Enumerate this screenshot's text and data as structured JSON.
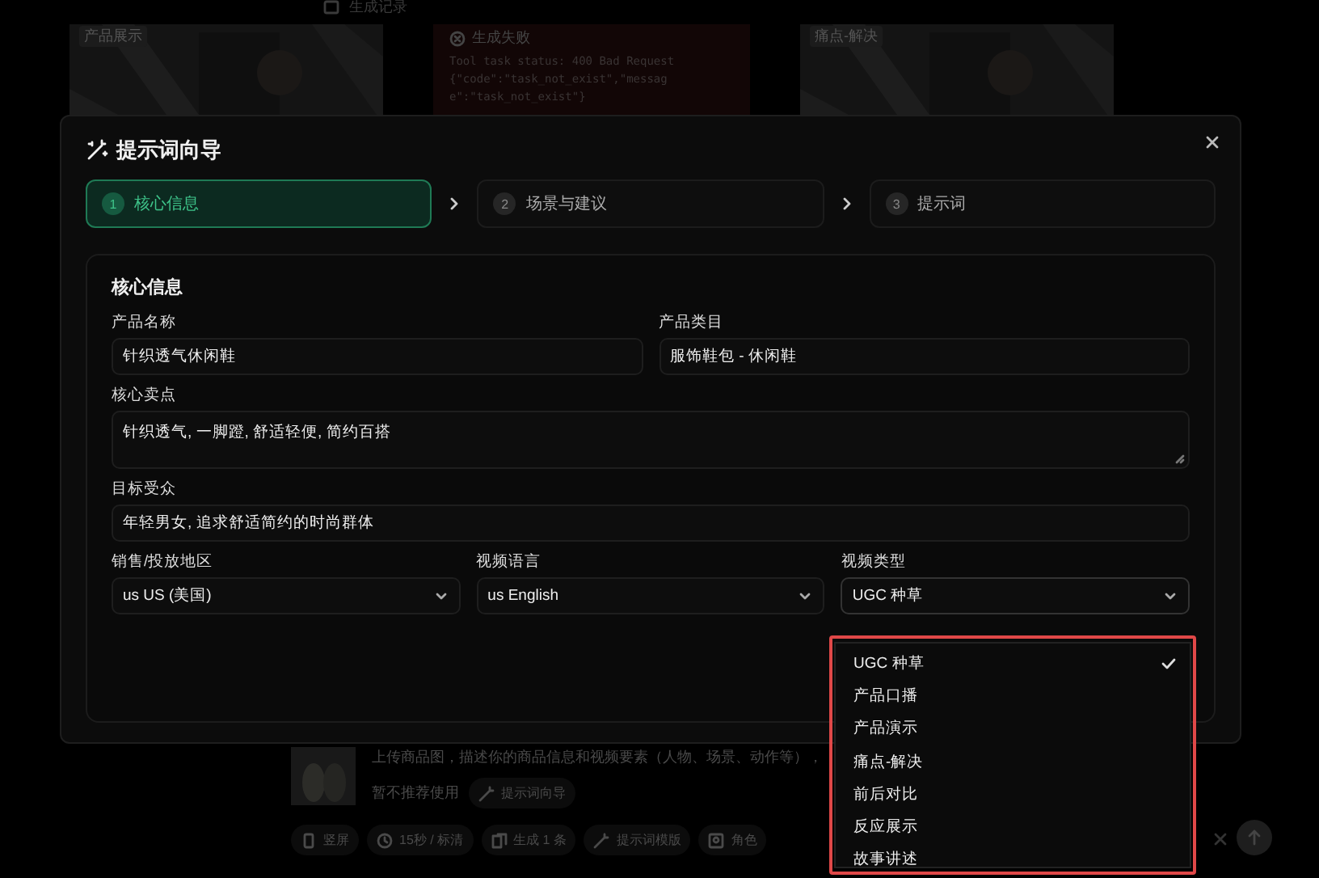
{
  "background": {
    "breadcrumb": "生成记录",
    "cards": [
      {
        "kind": "picture",
        "tag": "产品展示"
      },
      {
        "kind": "error",
        "title": "生成失败",
        "message": "Tool task status: 400 Bad Request {\"code\":\"task_not_exist\",\"message\":\"task_not_exist\"}"
      },
      {
        "kind": "picture",
        "tag": "痛点-解决"
      }
    ],
    "composer": {
      "description": "上传商品图，描述你的商品信息和视频要素（人物、场景、动作等），",
      "note": "暂不推荐使用",
      "wizard_button": "提示词向导",
      "options": [
        "竖屏",
        "15秒 / 标清",
        "生成 1 条",
        "提示词模版",
        "角色"
      ]
    }
  },
  "dialog": {
    "title": "提示词向导",
    "steps": [
      {
        "number": "1",
        "label": "核心信息",
        "selected": true
      },
      {
        "number": "2",
        "label": "场景与建议",
        "selected": false
      },
      {
        "number": "3",
        "label": "提示词",
        "selected": false
      }
    ],
    "section": {
      "title": "核心信息",
      "rows": [
        [
          {
            "kind": "text",
            "label": "产品名称",
            "value": "针织透气休闲鞋"
          },
          {
            "kind": "text",
            "label": "产品类目",
            "value": "服饰鞋包 - 休闲鞋"
          }
        ],
        [
          {
            "kind": "textarea",
            "label": "核心卖点",
            "value": "针织透气, 一脚蹬, 舒适轻便, 简约百搭"
          }
        ],
        [
          {
            "kind": "text",
            "label": "目标受众",
            "value": "年轻男女, 追求舒适简约的时尚群体"
          }
        ],
        [
          {
            "kind": "select",
            "label": "销售/投放地区",
            "value": "us US (美国)"
          },
          {
            "kind": "select",
            "label": "视频语言",
            "value": "us English"
          },
          {
            "kind": "select",
            "label": "视频类型",
            "value": "UGC 种草",
            "open": true
          }
        ]
      ]
    }
  },
  "dropdown": {
    "options": [
      {
        "label": "UGC 种草",
        "selected": true
      },
      {
        "label": "产品口播",
        "selected": false
      },
      {
        "label": "产品演示",
        "selected": false
      },
      {
        "label": "痛点-解决",
        "selected": false
      },
      {
        "label": "前后对比",
        "selected": false
      },
      {
        "label": "反应展示",
        "selected": false
      },
      {
        "label": "故事讲述",
        "selected": false
      }
    ]
  }
}
